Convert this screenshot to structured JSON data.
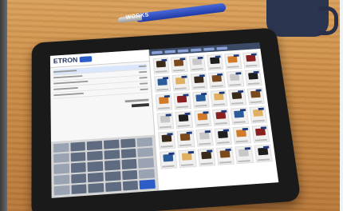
{
  "pen": {
    "brand_text": "WORKS"
  },
  "pos": {
    "logo_text": "ETRON",
    "order_line_count": 5,
    "keypad_key_count": 30,
    "product_tile_count": 36
  }
}
